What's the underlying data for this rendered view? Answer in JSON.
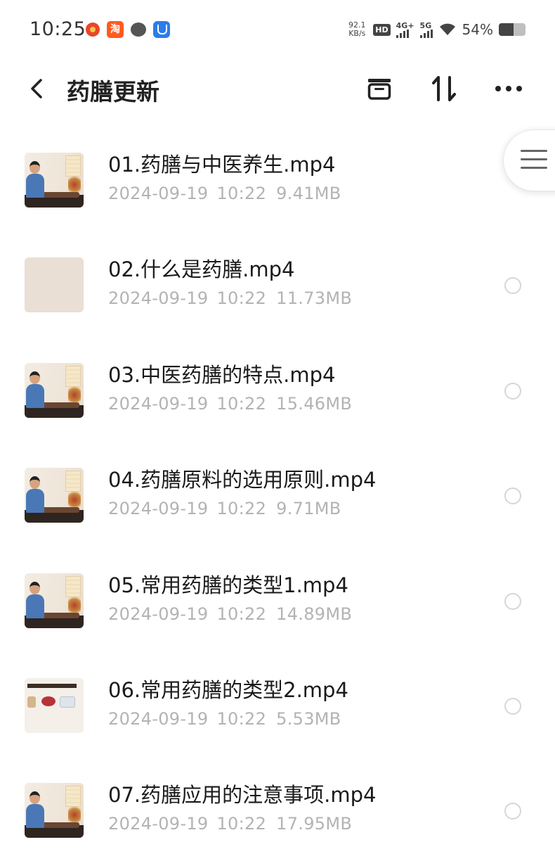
{
  "status_bar": {
    "time": "10:25",
    "net_speed_value": "92.1",
    "net_speed_unit": "KB/s",
    "hd_label": "HD",
    "sim1_label": "4G+",
    "sim2_label": "5G",
    "battery_percent": "54%",
    "battery_level": 0.54,
    "notification_icons": [
      "weather-icon",
      "taobao-icon",
      "chat-icon",
      "alarm-app-icon"
    ]
  },
  "header": {
    "title": "药膳更新",
    "back_icon": "chevron-left-icon",
    "actions": [
      "archive-box-icon",
      "sort-icon",
      "more-icon"
    ]
  },
  "files": [
    {
      "name": "01.药膳与中医养生.mp4",
      "date": "2024-09-19",
      "time": "10:22",
      "size": "9.41MB",
      "thumb": "video-frame"
    },
    {
      "name": "02.什么是药膳.mp4",
      "date": "2024-09-19",
      "time": "10:22",
      "size": "11.73MB",
      "thumb": "plain"
    },
    {
      "name": "03.中医药膳的特点.mp4",
      "date": "2024-09-19",
      "time": "10:22",
      "size": "15.46MB",
      "thumb": "video-frame"
    },
    {
      "name": "04.药膳原料的选用原则.mp4",
      "date": "2024-09-19",
      "time": "10:22",
      "size": "9.71MB",
      "thumb": "video-frame"
    },
    {
      "name": "05.常用药膳的类型1.mp4",
      "date": "2024-09-19",
      "time": "10:22",
      "size": "14.89MB",
      "thumb": "video-frame"
    },
    {
      "name": "06.常用药膳的类型2.mp4",
      "date": "2024-09-19",
      "time": "10:22",
      "size": "5.53MB",
      "thumb": "ingredients"
    },
    {
      "name": "07.药膳应用的注意事项.mp4",
      "date": "2024-09-19",
      "time": "10:22",
      "size": "17.95MB",
      "thumb": "video-frame"
    }
  ],
  "floating_menu_icon": "hamburger-menu-icon",
  "colors": {
    "text_primary": "#1a1a1a",
    "text_secondary": "#b3b3b3",
    "background": "#ffffff"
  }
}
